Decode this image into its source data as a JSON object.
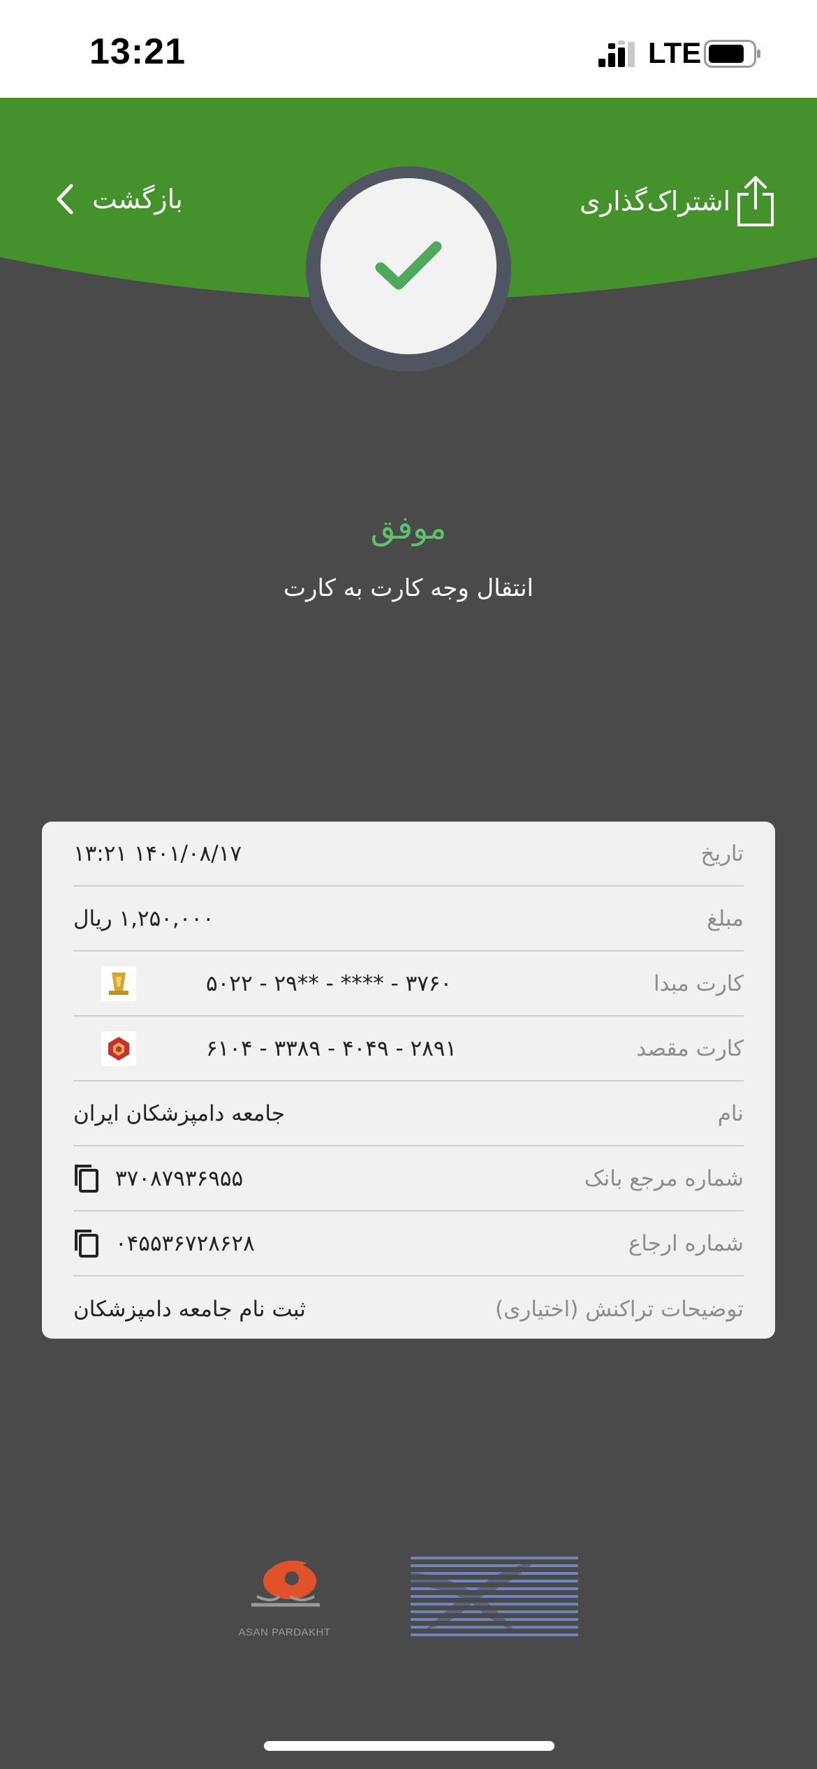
{
  "status_bar": {
    "time": "13:21",
    "network": "LTE"
  },
  "header": {
    "back_label": "بازگشت",
    "share_label": "اشتراک‌گذاری"
  },
  "result": {
    "status": "موفق",
    "description": "انتقال وجه کارت به کارت"
  },
  "details": [
    {
      "label": "تاریخ",
      "value": "۱۴۰۱/۰۸/۱۷ ۱۳:۲۱"
    },
    {
      "label": "مبلغ",
      "value": "۱,۲۵۰,۰۰۰ ریال"
    },
    {
      "label": "کارت مبدا",
      "value": "۵۰۲۲ - ۲۹** - **** - ۳۷۶۰"
    },
    {
      "label": "کارت مقصد",
      "value": "۶۱۰۴ - ۳۳۸۹ - ۴۰۴۹ - ۲۸۹۱"
    },
    {
      "label": "نام",
      "value": "جامعه دامپزشکان ایران"
    },
    {
      "label": "شماره مرجع بانک",
      "value": "۳۷۰۸۷۹۳۶۹۵۵"
    },
    {
      "label": "شماره ارجاع",
      "value": "۰۴۵۵۳۶۷۲۸۶۲۸"
    },
    {
      "label": "توضیحات تراکنش (اختیاری)",
      "value": "ثبت نام جامعه دامپزشکان"
    }
  ],
  "footer": {
    "asan_logo_text": "ASAN PARDAKHT"
  },
  "colors": {
    "header_green": "#45922c",
    "success_green": "#5ec16b",
    "background": "#4a4a4a",
    "card": "#f1f1f1"
  }
}
